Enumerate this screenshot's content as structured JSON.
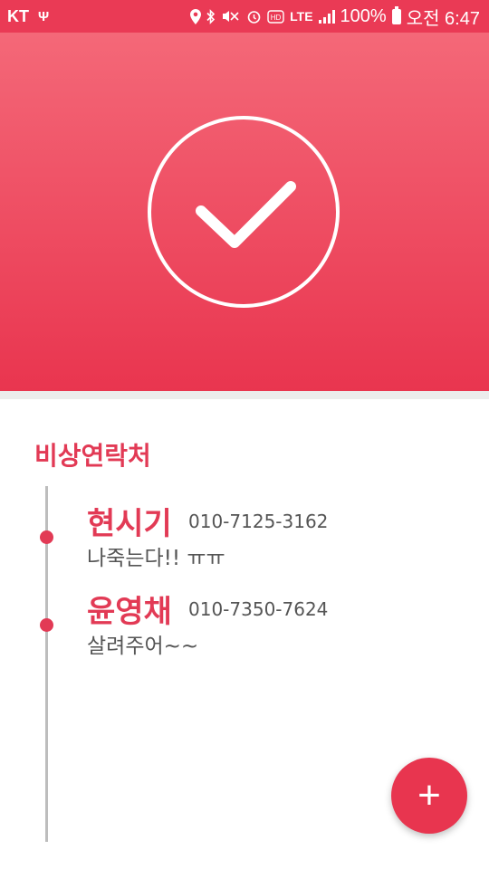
{
  "status_bar": {
    "carrier": "KT",
    "network": "LTE",
    "battery": "100%",
    "time": "오전 6:47",
    "icons": [
      "usb-icon",
      "location-icon",
      "bluetooth-icon",
      "mute-icon",
      "alarm-icon",
      "hd-voice-icon",
      "lte-icon",
      "signal-icon",
      "battery-icon"
    ]
  },
  "header": {
    "status_icon": "check-icon",
    "colors": {
      "gradient_top": "#f46878",
      "gradient_bottom": "#e9354f"
    }
  },
  "section": {
    "title": "비상연락처"
  },
  "contacts": [
    {
      "name": "현시기",
      "phone": "010-7125-3162",
      "message": "나죽는다!! ㅠㅠ"
    },
    {
      "name": "윤영채",
      "phone": "010-7350-7624",
      "message": "살려주어~~"
    }
  ],
  "fab": {
    "label": "+",
    "icon": "add-icon"
  },
  "colors": {
    "accent": "#e23a55",
    "timeline": "#bdbdbd",
    "secondary_text": "#555555"
  }
}
